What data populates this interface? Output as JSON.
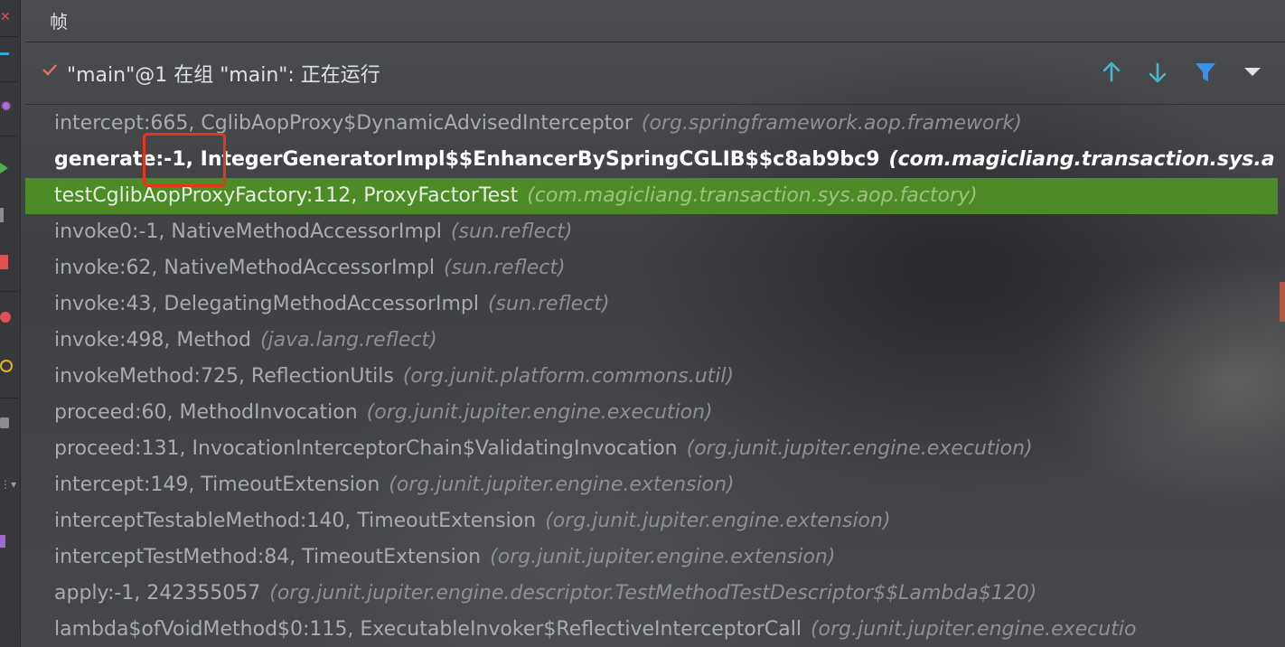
{
  "panel": {
    "title": "帧"
  },
  "thread": {
    "label": "\"main\"@1 在组 \"main\": 正在运行"
  },
  "toolbar": {
    "icons": [
      "arrow-up-icon",
      "arrow-down-icon",
      "filter-icon",
      "dropdown-icon"
    ]
  },
  "frames": [
    {
      "method": "intercept:665, CglibAopProxy$DynamicAdvisedInterceptor",
      "pkg": "(org.springframework.aop.framework)"
    },
    {
      "method": "generate:-1, IntegerGeneratorImpl$$EnhancerBySpringCGLIB$$c8ab9bc9",
      "pkg": "(com.magicliang.transaction.sys.a"
    },
    {
      "method": "testCglibAopProxyFactory:112, ProxyFactorTest",
      "pkg": "(com.magicliang.transaction.sys.aop.factory)"
    },
    {
      "method": "invoke0:-1, NativeMethodAccessorImpl",
      "pkg": "(sun.reflect)"
    },
    {
      "method": "invoke:62, NativeMethodAccessorImpl",
      "pkg": "(sun.reflect)"
    },
    {
      "method": "invoke:43, DelegatingMethodAccessorImpl",
      "pkg": "(sun.reflect)"
    },
    {
      "method": "invoke:498, Method",
      "pkg": "(java.lang.reflect)"
    },
    {
      "method": "invokeMethod:725, ReflectionUtils",
      "pkg": "(org.junit.platform.commons.util)"
    },
    {
      "method": "proceed:60, MethodInvocation",
      "pkg": "(org.junit.jupiter.engine.execution)"
    },
    {
      "method": "proceed:131, InvocationInterceptorChain$ValidatingInvocation",
      "pkg": "(org.junit.jupiter.engine.execution)"
    },
    {
      "method": "intercept:149, TimeoutExtension",
      "pkg": "(org.junit.jupiter.engine.extension)"
    },
    {
      "method": "interceptTestableMethod:140, TimeoutExtension",
      "pkg": "(org.junit.jupiter.engine.extension)"
    },
    {
      "method": "interceptTestMethod:84, TimeoutExtension",
      "pkg": "(org.junit.jupiter.engine.extension)"
    },
    {
      "method": "apply:-1, 242355057",
      "pkg": "(org.junit.jupiter.engine.descriptor.TestMethodTestDescriptor$$Lambda$120)"
    },
    {
      "method": "lambda$ofVoidMethod$0:115, ExecutableInvoker$ReflectiveInterceptorCall",
      "pkg": "(org.junit.jupiter.engine.executio"
    }
  ],
  "colors": {
    "selected_row": "#4d8b27",
    "highlight_box": "#e8341c",
    "up_down_icons": "#4fb3c8",
    "filter_icon": "#3d8fe0"
  }
}
